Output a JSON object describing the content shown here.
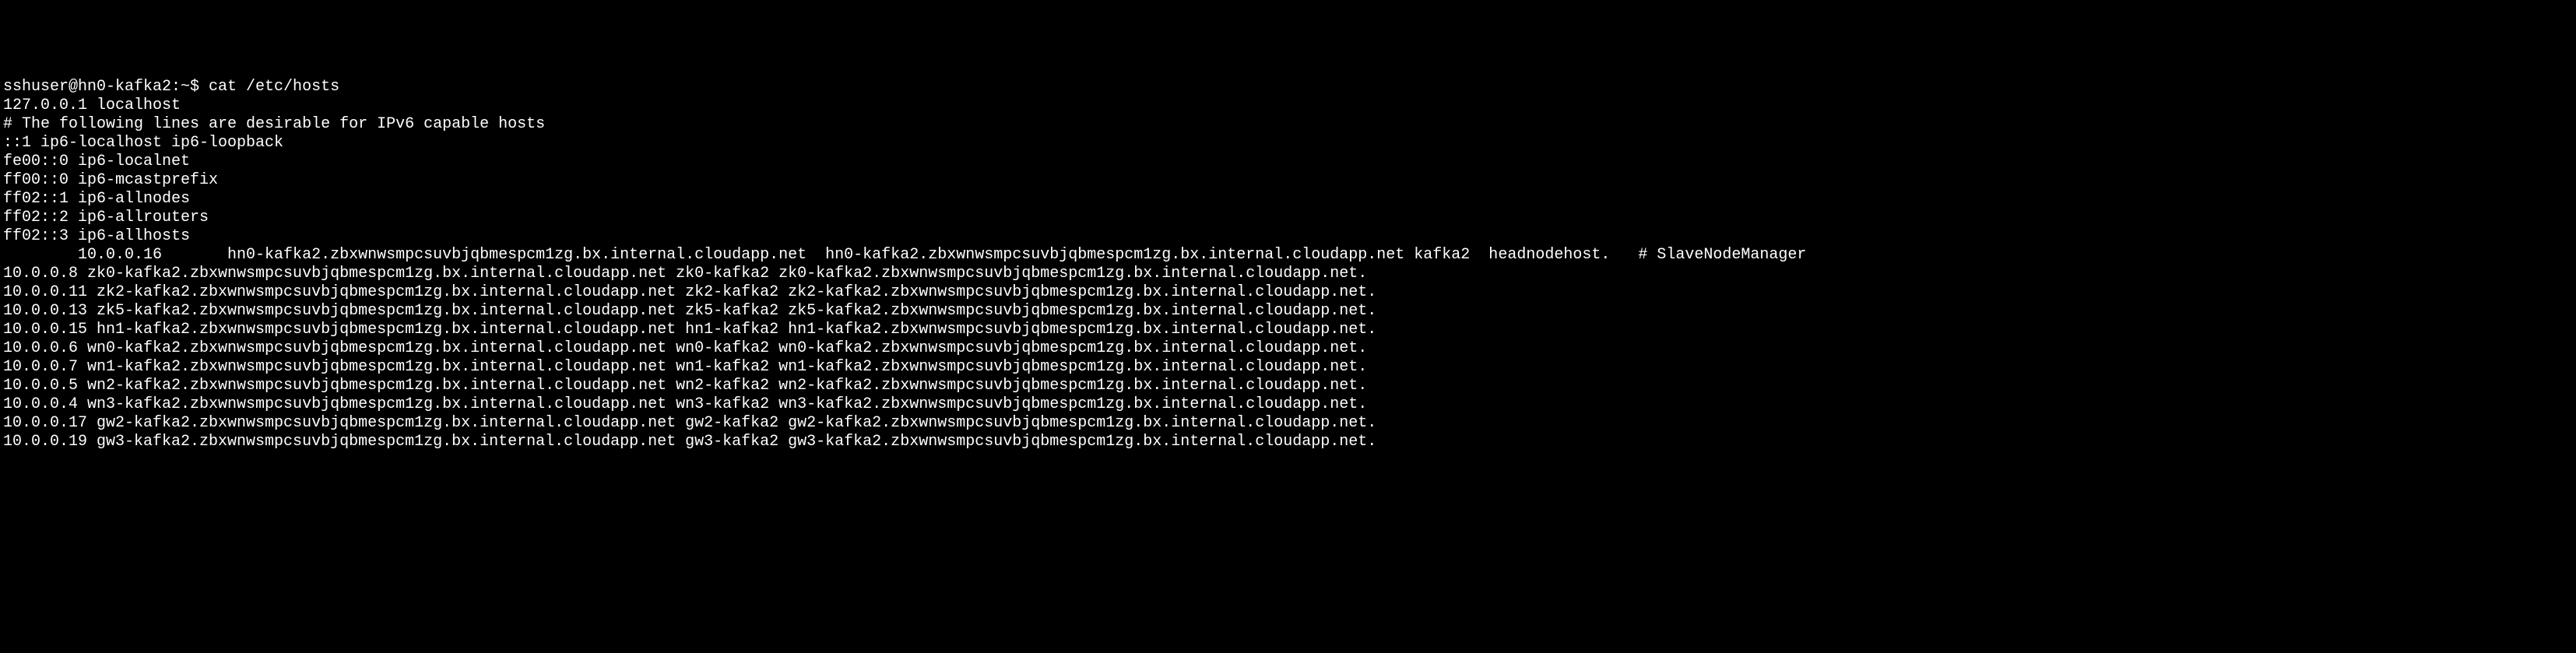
{
  "terminal": {
    "prompt": "sshuser@hn0-kafka2:~$ cat /etc/hosts",
    "lines": [
      "127.0.0.1 localhost",
      "",
      "# The following lines are desirable for IPv6 capable hosts",
      "::1 ip6-localhost ip6-loopback",
      "fe00::0 ip6-localnet",
      "ff00::0 ip6-mcastprefix",
      "ff02::1 ip6-allnodes",
      "ff02::2 ip6-allrouters",
      "ff02::3 ip6-allhosts",
      "        10.0.0.16       hn0-kafka2.zbxwnwsmpcsuvbjqbmespcm1zg.bx.internal.cloudapp.net  hn0-kafka2.zbxwnwsmpcsuvbjqbmespcm1zg.bx.internal.cloudapp.net kafka2  headnodehost.   # SlaveNodeManager",
      "10.0.0.8 zk0-kafka2.zbxwnwsmpcsuvbjqbmespcm1zg.bx.internal.cloudapp.net zk0-kafka2 zk0-kafka2.zbxwnwsmpcsuvbjqbmespcm1zg.bx.internal.cloudapp.net.",
      "10.0.0.11 zk2-kafka2.zbxwnwsmpcsuvbjqbmespcm1zg.bx.internal.cloudapp.net zk2-kafka2 zk2-kafka2.zbxwnwsmpcsuvbjqbmespcm1zg.bx.internal.cloudapp.net.",
      "10.0.0.13 zk5-kafka2.zbxwnwsmpcsuvbjqbmespcm1zg.bx.internal.cloudapp.net zk5-kafka2 zk5-kafka2.zbxwnwsmpcsuvbjqbmespcm1zg.bx.internal.cloudapp.net.",
      "10.0.0.15 hn1-kafka2.zbxwnwsmpcsuvbjqbmespcm1zg.bx.internal.cloudapp.net hn1-kafka2 hn1-kafka2.zbxwnwsmpcsuvbjqbmespcm1zg.bx.internal.cloudapp.net.",
      "10.0.0.6 wn0-kafka2.zbxwnwsmpcsuvbjqbmespcm1zg.bx.internal.cloudapp.net wn0-kafka2 wn0-kafka2.zbxwnwsmpcsuvbjqbmespcm1zg.bx.internal.cloudapp.net.",
      "10.0.0.7 wn1-kafka2.zbxwnwsmpcsuvbjqbmespcm1zg.bx.internal.cloudapp.net wn1-kafka2 wn1-kafka2.zbxwnwsmpcsuvbjqbmespcm1zg.bx.internal.cloudapp.net.",
      "10.0.0.5 wn2-kafka2.zbxwnwsmpcsuvbjqbmespcm1zg.bx.internal.cloudapp.net wn2-kafka2 wn2-kafka2.zbxwnwsmpcsuvbjqbmespcm1zg.bx.internal.cloudapp.net.",
      "10.0.0.4 wn3-kafka2.zbxwnwsmpcsuvbjqbmespcm1zg.bx.internal.cloudapp.net wn3-kafka2 wn3-kafka2.zbxwnwsmpcsuvbjqbmespcm1zg.bx.internal.cloudapp.net.",
      "10.0.0.17 gw2-kafka2.zbxwnwsmpcsuvbjqbmespcm1zg.bx.internal.cloudapp.net gw2-kafka2 gw2-kafka2.zbxwnwsmpcsuvbjqbmespcm1zg.bx.internal.cloudapp.net.",
      "10.0.0.19 gw3-kafka2.zbxwnwsmpcsuvbjqbmespcm1zg.bx.internal.cloudapp.net gw3-kafka2 gw3-kafka2.zbxwnwsmpcsuvbjqbmespcm1zg.bx.internal.cloudapp.net."
    ]
  }
}
